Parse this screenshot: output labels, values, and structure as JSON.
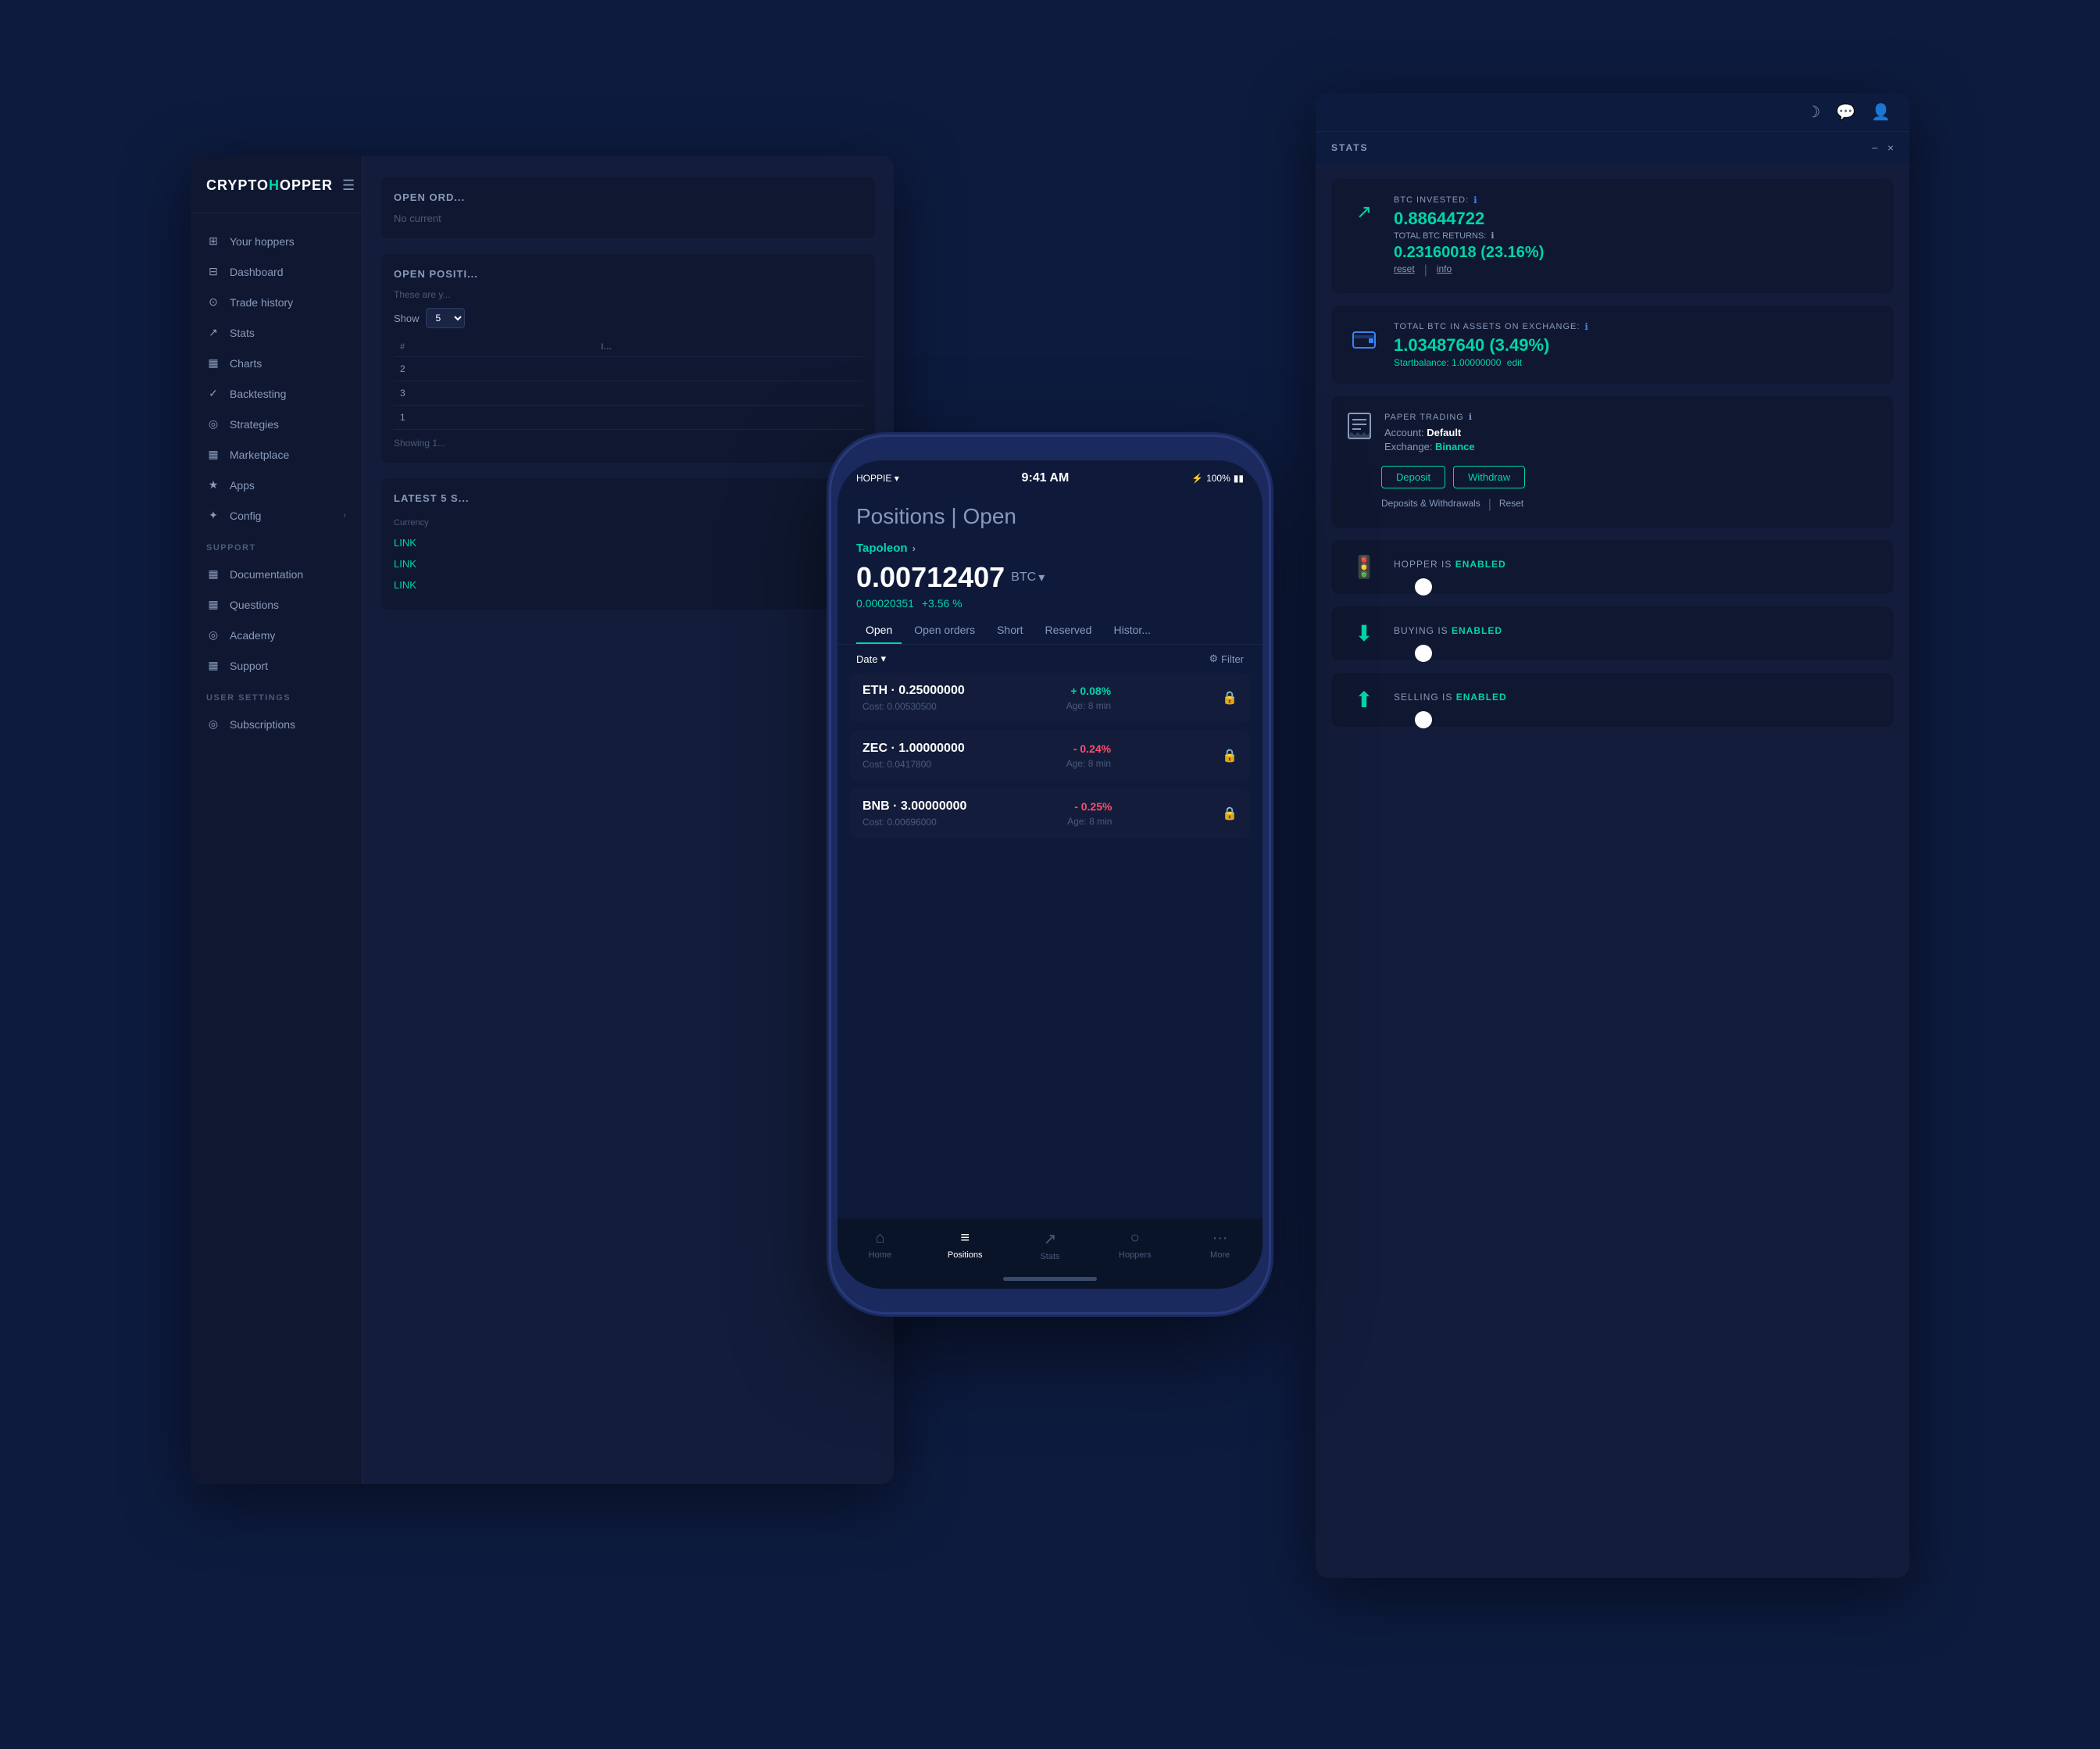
{
  "app": {
    "title": "CryptoHopper"
  },
  "topbar": {
    "icons": [
      "moon",
      "chat",
      "user"
    ]
  },
  "sidebar": {
    "logo": "CRYPTOHOPPER",
    "items": [
      {
        "id": "hoppers",
        "icon": "⊞",
        "label": "Your hoppers"
      },
      {
        "id": "dashboard",
        "icon": "⊟",
        "label": "Dashboard"
      },
      {
        "id": "trade-history",
        "icon": "⊙",
        "label": "Trade history"
      },
      {
        "id": "stats",
        "icon": "↗",
        "label": "Stats"
      },
      {
        "id": "charts",
        "icon": "▦",
        "label": "Charts"
      },
      {
        "id": "backtesting",
        "icon": "✓",
        "label": "Backtesting"
      },
      {
        "id": "strategies",
        "icon": "◎",
        "label": "Strategies"
      },
      {
        "id": "marketplace",
        "icon": "▦",
        "label": "Marketplace"
      },
      {
        "id": "apps",
        "icon": "★",
        "label": "Apps"
      },
      {
        "id": "config",
        "icon": "✦",
        "label": "Config",
        "arrow": "›"
      }
    ],
    "support_section": "SUPPORT",
    "support_items": [
      {
        "id": "documentation",
        "icon": "▦",
        "label": "Documentation"
      },
      {
        "id": "questions",
        "icon": "▦",
        "label": "Questions"
      },
      {
        "id": "academy",
        "icon": "◎",
        "label": "Academy"
      },
      {
        "id": "support",
        "icon": "▦",
        "label": "Support"
      }
    ],
    "user_settings_section": "USER SETTINGS",
    "user_items": [
      {
        "id": "subscriptions",
        "icon": "◎",
        "label": "Subscriptions"
      }
    ]
  },
  "main": {
    "open_orders_title": "OPEN ORD...",
    "open_orders_empty": "No current",
    "open_positions_title": "Open Positi...",
    "table_hint": "These are y...",
    "show_label": "Show",
    "show_value": "5",
    "table_headers": [
      "#",
      "I..."
    ],
    "table_rows": [
      {
        "num": "2"
      },
      {
        "num": "3"
      },
      {
        "num": "1"
      }
    ],
    "showing_label": "Showing 1...",
    "latest_section_title": "LATEST 5 S...",
    "currency_label": "Currency",
    "links": [
      "LINK",
      "LINK",
      "LINK"
    ]
  },
  "stats_panel": {
    "title": "STATS",
    "close_buttons": [
      "−",
      "×"
    ],
    "cards": [
      {
        "type": "btc-invested",
        "icon": "↗",
        "icon_color": "teal",
        "label": "BTC INVESTED:",
        "has_info": true,
        "value": "0.88644722",
        "sublabel": "TOTAL BTC RETURNS:",
        "has_sublabel_info": true,
        "subvalue": "0.23160018 (23.16%)",
        "links": [
          "reset",
          "info"
        ]
      },
      {
        "type": "btc-assets",
        "icon": "▣",
        "icon_color": "blue",
        "label": "TOTAL BTC IN ASSETS ON EXCHANGE:",
        "has_info": true,
        "value": "1.03487640 (3.49%)",
        "startbalance": "Startbalance: 1.00000000",
        "edit_link": "edit"
      },
      {
        "type": "paper-trading",
        "label": "PAPER TRADING",
        "has_info": true,
        "account": "Default",
        "exchange": "Binance",
        "buttons": [
          "Deposit",
          "Withdraw"
        ],
        "links": [
          "Deposits & Withdrawals",
          "Reset"
        ]
      },
      {
        "type": "hopper-toggle",
        "icon": "🚦",
        "icon_color": "green",
        "label": "HOPPER IS",
        "enabled_text": "ENABLED",
        "enabled": true
      },
      {
        "type": "buying-toggle",
        "icon": "⬇",
        "icon_color": "teal",
        "label": "BUYING IS",
        "enabled_text": "ENABLED",
        "enabled": true
      },
      {
        "type": "selling-toggle",
        "icon": "⬆",
        "icon_color": "teal",
        "label": "SELLING IS",
        "enabled_text": "ENABLED",
        "enabled": true
      }
    ]
  },
  "phone": {
    "carrier": "HOPPIE",
    "time": "9:41 AM",
    "battery": "100%",
    "page_title": "Positions",
    "page_subtitle": "Open",
    "portfolio_name": "Tapoleon",
    "portfolio_value": "0.00712407",
    "portfolio_currency": "BTC",
    "portfolio_change_abs": "0.00020351",
    "portfolio_change_pct": "+3.56 %",
    "tabs": [
      "Open",
      "Open orders",
      "Short",
      "Reserved",
      "Histor..."
    ],
    "active_tab": "Open",
    "filter_date": "Date",
    "filter_button": "Filter",
    "positions": [
      {
        "name": "ETH · 0.25000000",
        "cost": "Cost: 0.00530500",
        "pct": "+ 0.08%",
        "positive": true,
        "age": "Age: 8 min"
      },
      {
        "name": "ZEC · 1.00000000",
        "cost": "Cost: 0.0417800",
        "pct": "- 0.24%",
        "positive": false,
        "age": "Age: 8 min"
      },
      {
        "name": "BNB · 3.00000000",
        "cost": "Cost: 0.00696000",
        "pct": "- 0.25%",
        "positive": false,
        "age": "Age: 8 min"
      }
    ],
    "bottom_nav": [
      {
        "icon": "⌂",
        "label": "Home",
        "active": false
      },
      {
        "icon": "≡",
        "label": "Positions",
        "active": true
      },
      {
        "icon": "↗",
        "label": "Stats",
        "active": false
      },
      {
        "icon": "○",
        "label": "Hoppers",
        "active": false
      },
      {
        "icon": "···",
        "label": "More",
        "active": false
      }
    ]
  }
}
